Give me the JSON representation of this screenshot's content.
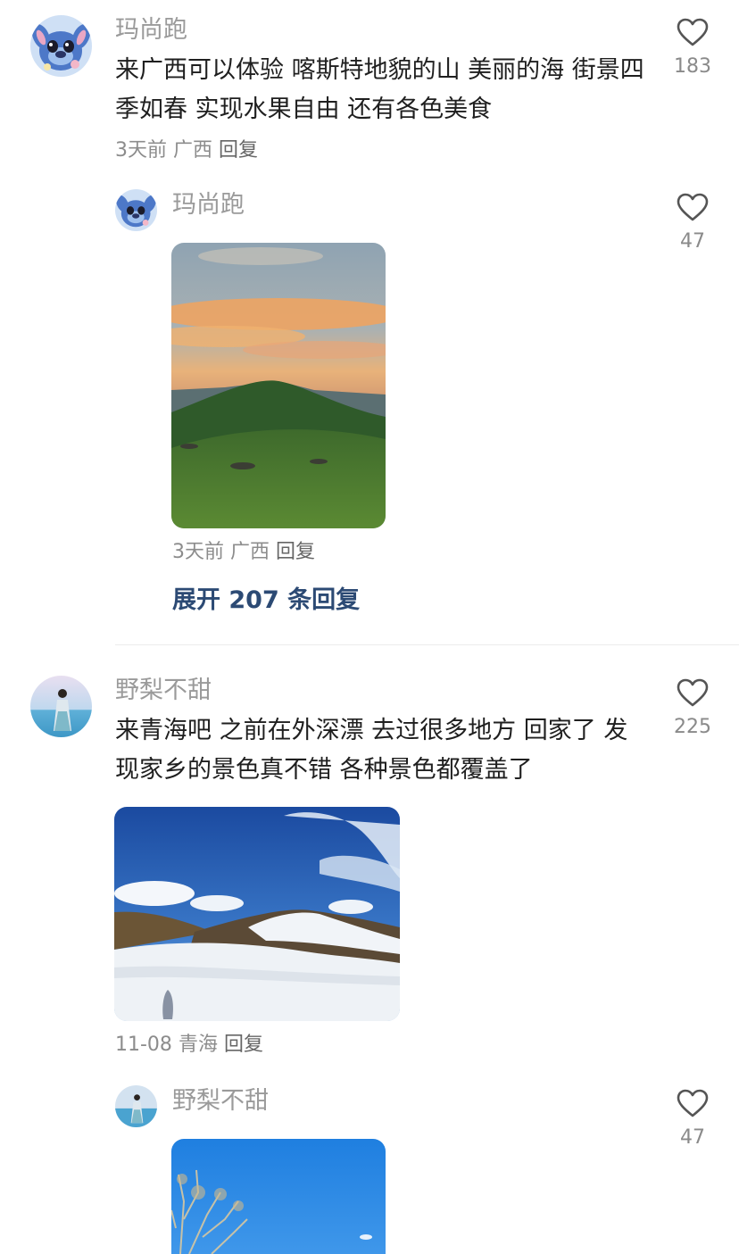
{
  "comments": [
    {
      "username": "玛尚跑",
      "text": "来广西可以体验 喀斯特地貌的山  美丽的海  街景四季如春 实现水果自由 还有各色美食",
      "time": "3天前",
      "location": "广西",
      "reply": "回复",
      "likes": "183",
      "avatar_icon": "stitch-avatar-icon",
      "reply_item": {
        "username": "玛尚跑",
        "likes": "47",
        "time": "3天前",
        "location": "广西",
        "reply": "回复"
      },
      "expand_label": "展开 207 条回复"
    },
    {
      "username": "野梨不甜",
      "text": "来青海吧 之前在外深漂 去过很多地方 回家了 发现家乡的景色真不错 各种景色都覆盖了",
      "time": "11-08",
      "location": "青海",
      "reply": "回复",
      "likes": "225",
      "avatar_icon": "seaside-girl-avatar-icon",
      "reply_item": {
        "username": "野梨不甜",
        "likes": "47"
      }
    }
  ],
  "colors": {
    "username": "#9a9a9a",
    "text": "#1f1f1f",
    "meta": "#8c8c8c",
    "expand": "#2c4a74",
    "divider": "#ebebeb"
  }
}
